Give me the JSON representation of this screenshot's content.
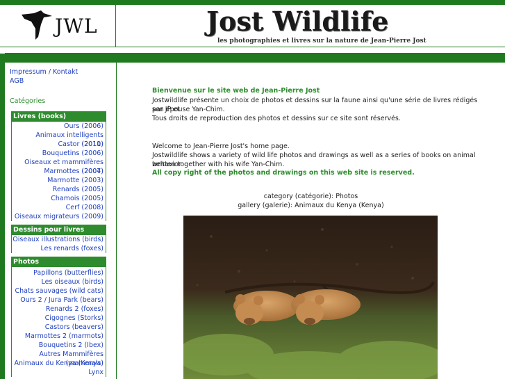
{
  "header": {
    "logo_text": "JWL",
    "title": "Jost Wildlife",
    "subtitle": "les photographies et livres sur la nature de Jean-Pierre Jost"
  },
  "sidebar": {
    "links": [
      "Impressum / Kontakt",
      "AGB"
    ],
    "categories_label": "Catégories",
    "sections": [
      {
        "title": "Livres (books)",
        "items": [
          "Ours (2006)",
          "Animaux intelligents (2010)",
          "Castor (2011)",
          "Bouquetins (2006)",
          "Oiseaux et mammifères (2007)",
          "Marmottes (2004)",
          "Marmotte (2003)",
          "Renards (2005)",
          "Chamois (2005)",
          "Cerf (2008)",
          "Oiseaux migrateurs (2009)"
        ]
      },
      {
        "title": "Dessins pour livres",
        "items": [
          "Oiseaux illustrations (birds)",
          "Les renards (foxes)"
        ]
      },
      {
        "title": "Photos",
        "items": [
          "Papillons (butterflies)",
          "Les oiseaux (birds)",
          "Chats sauvages (wild cats)",
          "Ours 2 / Jura Park (bears)",
          "Renards 2 (foxes)",
          "Cigognes (Storks)",
          "Castors (beavers)",
          "Marmottes 2 (marmots)",
          "Bouquetins 2 (Ibex)",
          "Autres Mammifères (mammals)",
          "Animaux du Kenya (Kenya)",
          "Lynx"
        ]
      }
    ]
  },
  "main": {
    "fr_heading": "Bienvenue sur le site web de Jean-Pierre Jost",
    "fr_line1": "Jostwildlife présente un choix de photos et dessins sur la faune ainsi qu'une série de livres rédigés par JP et",
    "fr_line2": "son épouse Yan-Chim.",
    "fr_line3": "Tous droits de reproduction des photos et dessins sur ce site sont réservés.",
    "en_line1": "Welcome to Jean-Pierre Jost's home page.",
    "en_line2": "Jostwildlife shows a variety of wild life photos and drawings as well as a series of books on animal behavior",
    "en_line3": "written together with his wife Yan-Chim.",
    "en_copyright": "All copy right of the photos and drawings on this web site is reserved.",
    "category_line": "category (catégorie): Photos",
    "gallery_line": "gallery (galerie): Animaux du Kenya (Kenya)"
  },
  "colors": {
    "brand_green": "#2e8b2e",
    "link_blue": "#1f3fbf"
  },
  "icons": [
    "eagle-logo-icon"
  ]
}
